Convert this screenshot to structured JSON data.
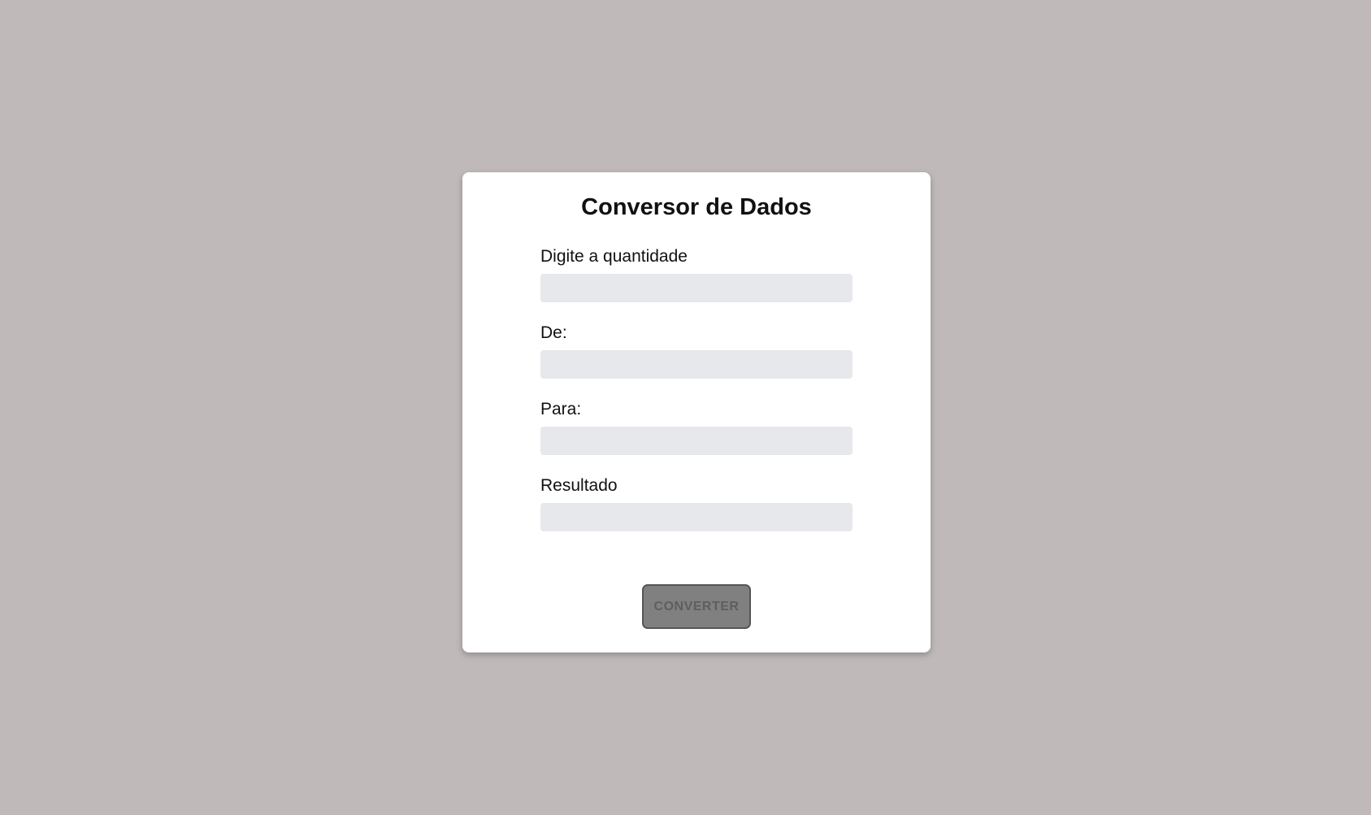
{
  "form": {
    "title": "Conversor de Dados",
    "fields": [
      {
        "label": "Digite a quantidade",
        "value": "",
        "placeholder": ""
      },
      {
        "label": "De:",
        "value": "",
        "placeholder": ""
      },
      {
        "label": "Para:",
        "value": "",
        "placeholder": ""
      },
      {
        "label": "Resultado",
        "value": "",
        "placeholder": ""
      }
    ],
    "button_label": "CONVERTER"
  },
  "colors": {
    "background": "#bfb9b9",
    "card": "#ffffff",
    "input_bg": "#e6e8eb",
    "button_bg": "#808080",
    "button_text": "#5e5e5e"
  }
}
